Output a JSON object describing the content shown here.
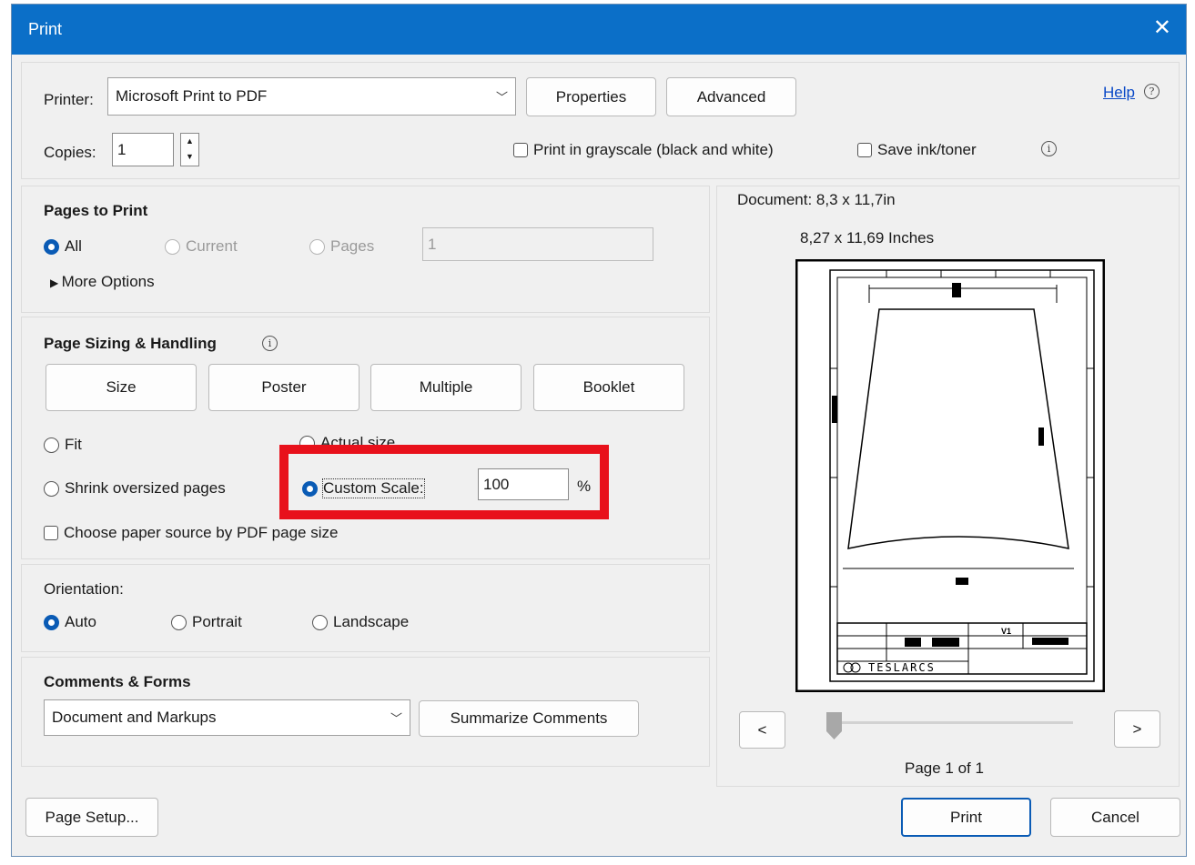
{
  "title": "Print",
  "printer": {
    "label": "Printer:",
    "value": "Microsoft Print to PDF",
    "properties": "Properties",
    "advanced": "Advanced",
    "help": "Help"
  },
  "copies": {
    "label": "Copies:",
    "value": "1"
  },
  "options": {
    "grayscale": "Print in grayscale (black and white)",
    "save_ink": "Save ink/toner"
  },
  "pages": {
    "heading": "Pages to Print",
    "all": "All",
    "current": "Current",
    "pages": "Pages",
    "pages_value": "1",
    "more": "More Options"
  },
  "sizing": {
    "heading": "Page Sizing & Handling",
    "tabs": [
      "Size",
      "Poster",
      "Multiple",
      "Booklet"
    ],
    "fit": "Fit",
    "actual": "Actual size",
    "shrink": "Shrink oversized pages",
    "custom": "Custom Scale:",
    "scale_value": "100",
    "percent": "%",
    "paper_source": "Choose paper source by PDF page size"
  },
  "orientation": {
    "heading": "Orientation:",
    "auto": "Auto",
    "portrait": "Portrait",
    "landscape": "Landscape"
  },
  "comments": {
    "heading": "Comments & Forms",
    "value": "Document and Markups",
    "summarize": "Summarize Comments"
  },
  "preview": {
    "document": "Document: 8,3 x 11,7in",
    "size": "8,27 x 11,69 Inches",
    "prev": "<",
    "next": ">",
    "page": "Page 1 of 1",
    "logo": "TESLARCS",
    "version": "V1"
  },
  "footer": {
    "setup": "Page Setup...",
    "print": "Print",
    "cancel": "Cancel"
  },
  "colors": {
    "titlebar": "#0b6fc8",
    "highlight": "#e8111b",
    "link": "#0a49c7"
  }
}
